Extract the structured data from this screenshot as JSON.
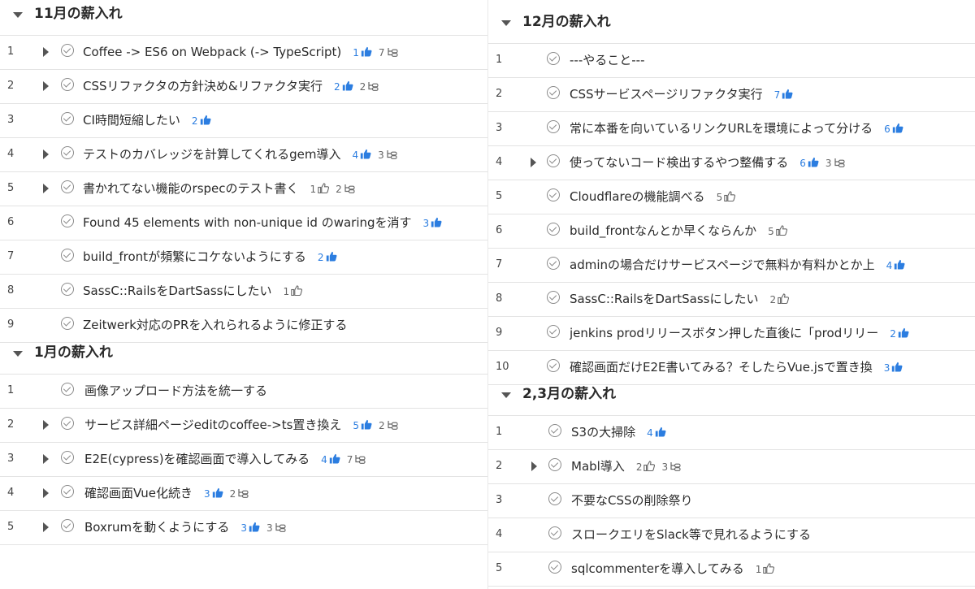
{
  "colors": {
    "accent": "#2b7de0",
    "text": "#2a2a2a",
    "muted": "#666666",
    "border": "#e3e3e3"
  },
  "sections": [
    {
      "id": "nov",
      "title": "11月の薪入れ",
      "column": "left",
      "tasks": [
        {
          "num": "1",
          "title": "Coffee -> ES6 on Webpack (-> TypeScript)",
          "likes": "1",
          "liked": true,
          "subtasks": "7",
          "expandable": true
        },
        {
          "num": "2",
          "title": "CSSリファクタの方針決め&リファクタ実行",
          "likes": "2",
          "liked": true,
          "subtasks": "2",
          "expandable": true
        },
        {
          "num": "3",
          "title": "CI時間短縮したい",
          "likes": "2",
          "liked": true,
          "subtasks": null,
          "expandable": false
        },
        {
          "num": "4",
          "title": "テストのカバレッジを計算してくれるgem導入",
          "likes": "4",
          "liked": true,
          "subtasks": "3",
          "expandable": true
        },
        {
          "num": "5",
          "title": "書かれてない機能のrspecのテスト書く",
          "likes": "1",
          "liked": false,
          "subtasks": "2",
          "expandable": true
        },
        {
          "num": "6",
          "title": "Found 45 elements with non-unique id のwaringを消す",
          "likes": "3",
          "liked": true,
          "subtasks": null,
          "expandable": false
        },
        {
          "num": "7",
          "title": "build_frontが頻繁にコケないようにする",
          "likes": "2",
          "liked": true,
          "subtasks": null,
          "expandable": false
        },
        {
          "num": "8",
          "title": "SassC::RailsをDartSassにしたい",
          "likes": "1",
          "liked": false,
          "subtasks": null,
          "expandable": false
        },
        {
          "num": "9",
          "title": "Zeitwerk対応のPRを入れられるように修正する",
          "likes": null,
          "liked": false,
          "subtasks": null,
          "expandable": false
        }
      ]
    },
    {
      "id": "jan",
      "title": "1月の薪入れ",
      "column": "left",
      "tasks": [
        {
          "num": "1",
          "title": "画像アップロード方法を統一する",
          "likes": null,
          "liked": false,
          "subtasks": null,
          "expandable": false
        },
        {
          "num": "2",
          "title": "サービス詳細ページeditのcoffee->ts置き換え",
          "likes": "5",
          "liked": true,
          "subtasks": "2",
          "expandable": true
        },
        {
          "num": "3",
          "title": "E2E(cypress)を確認画面で導入してみる",
          "likes": "4",
          "liked": true,
          "subtasks": "7",
          "expandable": true
        },
        {
          "num": "4",
          "title": "確認画面Vue化続き",
          "likes": "3",
          "liked": true,
          "subtasks": "2",
          "expandable": true
        },
        {
          "num": "5",
          "title": "Boxrumを動くようにする",
          "likes": "3",
          "liked": true,
          "subtasks": "3",
          "expandable": true
        }
      ]
    },
    {
      "id": "dec",
      "title": "12月の薪入れ",
      "column": "right",
      "tasks": [
        {
          "num": "1",
          "title": "---やること---",
          "likes": null,
          "liked": false,
          "subtasks": null,
          "expandable": false
        },
        {
          "num": "2",
          "title": "CSSサービスページリファクタ実行",
          "likes": "7",
          "liked": true,
          "subtasks": null,
          "expandable": false
        },
        {
          "num": "3",
          "title": "常に本番を向いているリンクURLを環境によって分ける",
          "likes": "6",
          "liked": true,
          "subtasks": null,
          "expandable": false
        },
        {
          "num": "4",
          "title": "使ってないコード検出するやつ整備する",
          "likes": "6",
          "liked": true,
          "subtasks": "3",
          "expandable": true
        },
        {
          "num": "5",
          "title": "Cloudflareの機能調べる",
          "likes": "5",
          "liked": false,
          "subtasks": null,
          "expandable": false
        },
        {
          "num": "6",
          "title": "build_frontなんとか早くならんか",
          "likes": "5",
          "liked": false,
          "subtasks": null,
          "expandable": false
        },
        {
          "num": "7",
          "title": "adminの場合だけサービスページで無料か有料かとか上",
          "likes": "4",
          "liked": true,
          "subtasks": null,
          "expandable": false
        },
        {
          "num": "8",
          "title": "SassC::RailsをDartSassにしたい",
          "likes": "2",
          "liked": false,
          "subtasks": null,
          "expandable": false
        },
        {
          "num": "9",
          "title": "jenkins prodリリースボタン押した直後に「prodリリー",
          "likes": "2",
          "liked": true,
          "subtasks": null,
          "expandable": false
        },
        {
          "num": "10",
          "title": "確認画面だけE2E書いてみる？そしたらVue.jsで置き換",
          "likes": "3",
          "liked": true,
          "subtasks": null,
          "expandable": false
        }
      ]
    },
    {
      "id": "feb-mar",
      "title": "2,3月の薪入れ",
      "column": "right",
      "tasks": [
        {
          "num": "1",
          "title": "S3の大掃除",
          "likes": "4",
          "liked": true,
          "subtasks": null,
          "expandable": false
        },
        {
          "num": "2",
          "title": "Mabl導入",
          "likes": "2",
          "liked": false,
          "subtasks": "3",
          "expandable": true
        },
        {
          "num": "3",
          "title": "不要なCSSの削除祭り",
          "likes": null,
          "liked": false,
          "subtasks": null,
          "expandable": false
        },
        {
          "num": "4",
          "title": "スロークエリをSlack等で見れるようにする",
          "likes": null,
          "liked": false,
          "subtasks": null,
          "expandable": false
        },
        {
          "num": "5",
          "title": "sqlcommenterを導入してみる",
          "likes": "1",
          "liked": false,
          "subtasks": null,
          "expandable": false
        }
      ]
    }
  ]
}
